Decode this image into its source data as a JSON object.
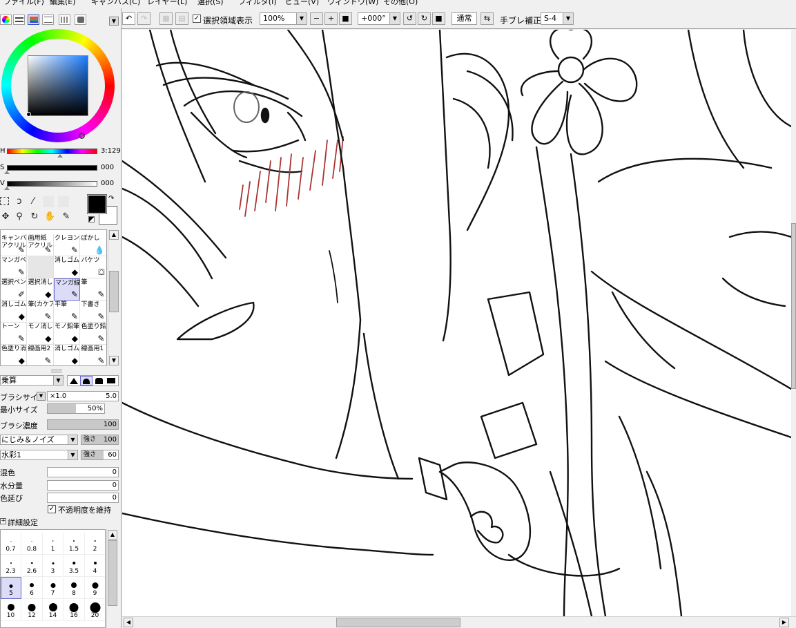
{
  "menubar": {
    "items": [
      "ファイル(F)",
      "編集(E)",
      "キャンバス(C)",
      "レイヤー(L)",
      "選択(S)",
      "フィルタ(I)",
      "ビュー(V)",
      "ウィンドウ(W)",
      "その他(O)"
    ]
  },
  "color_panel": {
    "h_label": "H",
    "h_value": "3:129",
    "s_label": "S",
    "s_value": "000",
    "v_label": "V",
    "v_value": "000",
    "fg_color": "#000000",
    "bg_color": "#ffffff"
  },
  "tools": {
    "row1": [
      "select-rect-icon",
      "lasso-icon",
      "magic-wand-icon"
    ],
    "row2": [
      "move-icon",
      "zoom-icon",
      "rotate-icon",
      "hand-icon",
      "eyedropper-icon"
    ]
  },
  "brushes": [
    {
      "name": "キャンバス",
      "sub": "アクリル"
    },
    {
      "name": "画用紙",
      "sub": "アクリル"
    },
    {
      "name": "クレヨン",
      "sub": ""
    },
    {
      "name": "ぼかし",
      "sub": ""
    },
    {
      "name": "マンガペン",
      "sub": ""
    },
    {
      "name": "",
      "sub": ""
    },
    {
      "name": "消しゴム",
      "sub": ""
    },
    {
      "name": "バケツ",
      "sub": ""
    },
    {
      "name": "選択ペン",
      "sub": ""
    },
    {
      "name": "選択消し",
      "sub": ""
    },
    {
      "name": "マンガ線",
      "sub": ""
    },
    {
      "name": "筆",
      "sub": ""
    },
    {
      "name": "消しゴム",
      "sub": ""
    },
    {
      "name": "筆(カケア",
      "sub": ""
    },
    {
      "name": "平筆",
      "sub": ""
    },
    {
      "name": "下書き",
      "sub": ""
    },
    {
      "name": "トーン",
      "sub": ""
    },
    {
      "name": "モノ消しE",
      "sub": ""
    },
    {
      "name": "モノ鉛筆",
      "sub": ""
    },
    {
      "name": "色塗り鉛",
      "sub": ""
    },
    {
      "name": "色塗り消",
      "sub": ""
    },
    {
      "name": "線画用2",
      "sub": ""
    },
    {
      "name": "消しゴム",
      "sub": ""
    },
    {
      "name": "線画用1",
      "sub": ""
    }
  ],
  "brush_settings": {
    "blend_mode": "乗算",
    "brush_size_label": "ブラシサイズ",
    "brush_size_mult": "×1.0",
    "brush_size_value": "5.0",
    "min_size_label": "最小サイズ",
    "min_size_value": "50%",
    "min_size_fill": 0.5,
    "density_label": "ブラシ濃度",
    "density_value": "100",
    "texture1": "にじみ＆ノイズ",
    "texture1_strength_label": "強さ",
    "texture1_strength": "100",
    "texture2": "水彩1",
    "texture2_strength_label": "強さ",
    "texture2_strength": "60",
    "mix_label": "混色",
    "mix_value": "0",
    "water_label": "水分量",
    "water_value": "0",
    "spread_label": "色延び",
    "spread_value": "0",
    "keep_opacity_label": "不透明度を維持",
    "keep_opacity_checked": "✓",
    "detail_label": "詳細設定",
    "detail_toggle": "+"
  },
  "size_presets": [
    "0.7",
    "0.8",
    "1",
    "1.5",
    "2",
    "2.3",
    "2.6",
    "3",
    "3.5",
    "4",
    "5",
    "6",
    "7",
    "8",
    "9",
    "10",
    "12",
    "14",
    "16",
    "20"
  ],
  "size_selected": "5",
  "toolbar": {
    "show_selection_label": "選択領域表示",
    "show_selection_checked": "✓",
    "zoom": "100%",
    "angle": "+000°",
    "blend": "通常",
    "stabilizer_label": "手ブレ補正",
    "stabilizer_value": "S-4"
  }
}
